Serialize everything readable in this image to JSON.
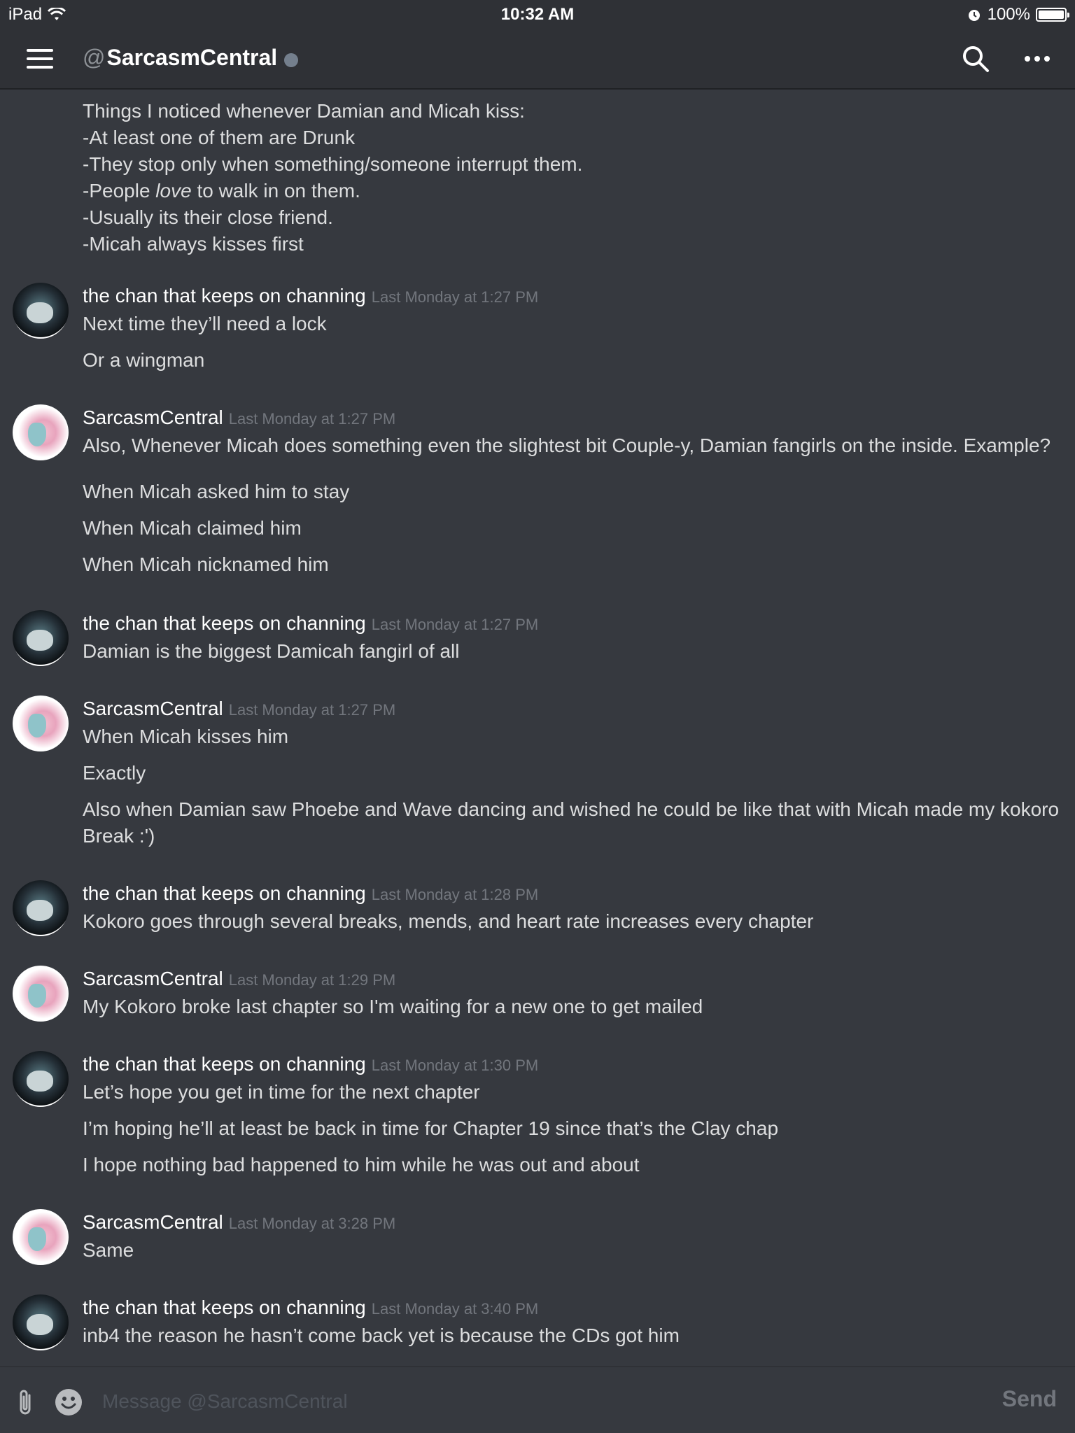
{
  "status_bar": {
    "device": "iPad",
    "time": "10:32 AM",
    "battery": "100%"
  },
  "header": {
    "at_symbol": "@",
    "channel_name": "SarcasmCentral"
  },
  "composer": {
    "placeholder": "Message @SarcasmCentral",
    "send_label": "Send"
  },
  "messages": {
    "m0": {
      "lines": [
        "Things I noticed whenever Damian and Micah kiss:",
        "-At least one of them are Drunk",
        "-They stop only when something/someone interrupt them.",
        "-People ",
        "love",
        " to walk in on them.",
        "-Usually its their close friend.",
        "-Micah always kisses first"
      ]
    },
    "m1": {
      "author": "the chan that keeps on channing",
      "timestamp": "Last Monday at 1:27 PM",
      "lines": [
        "Next time they’ll need a lock",
        "Or a wingman"
      ]
    },
    "m2": {
      "author": "SarcasmCentral",
      "timestamp": "Last Monday at 1:27 PM",
      "lines": [
        "Also, Whenever Micah does something even the slightest bit Couple-y, Damian fangirls on the inside. Example?",
        "When Micah asked him to stay",
        "When Micah claimed him",
        "When Micah nicknamed him"
      ]
    },
    "m3": {
      "author": "the chan that keeps on channing",
      "timestamp": "Last Monday at 1:27 PM",
      "lines": [
        "Damian is the biggest Damicah fangirl of all"
      ]
    },
    "m4": {
      "author": "SarcasmCentral",
      "timestamp": "Last Monday at 1:27 PM",
      "lines": [
        "When Micah kisses him",
        "Exactly",
        "Also when Damian saw Phoebe and Wave dancing and wished he could be like that with Micah made my kokoro Break :')"
      ]
    },
    "m5": {
      "author": "the chan that keeps on channing",
      "timestamp": "Last Monday at 1:28 PM",
      "lines": [
        "Kokoro goes through several breaks, mends, and heart rate increases every chapter"
      ]
    },
    "m6": {
      "author": "SarcasmCentral",
      "timestamp": "Last Monday at 1:29 PM",
      "lines": [
        "My Kokoro broke last chapter so I'm waiting for a new one to get mailed"
      ]
    },
    "m7": {
      "author": "the chan that keeps on channing",
      "timestamp": "Last Monday at 1:30 PM",
      "lines": [
        "Let’s hope you get in time for the next chapter",
        "I’m hoping he’ll at least be back in time for Chapter 19 since that’s the Clay chap",
        "I hope nothing bad happened to him while he was out and about"
      ]
    },
    "m8": {
      "author": "SarcasmCentral",
      "timestamp": "Last Monday at 3:28 PM",
      "lines": [
        "Same"
      ]
    },
    "m9": {
      "author": "the chan that keeps on channing",
      "timestamp": "Last Monday at 3:40 PM",
      "lines": [
        "inb4 the reason he hasn’t come back yet is because the CDs got him"
      ]
    }
  }
}
